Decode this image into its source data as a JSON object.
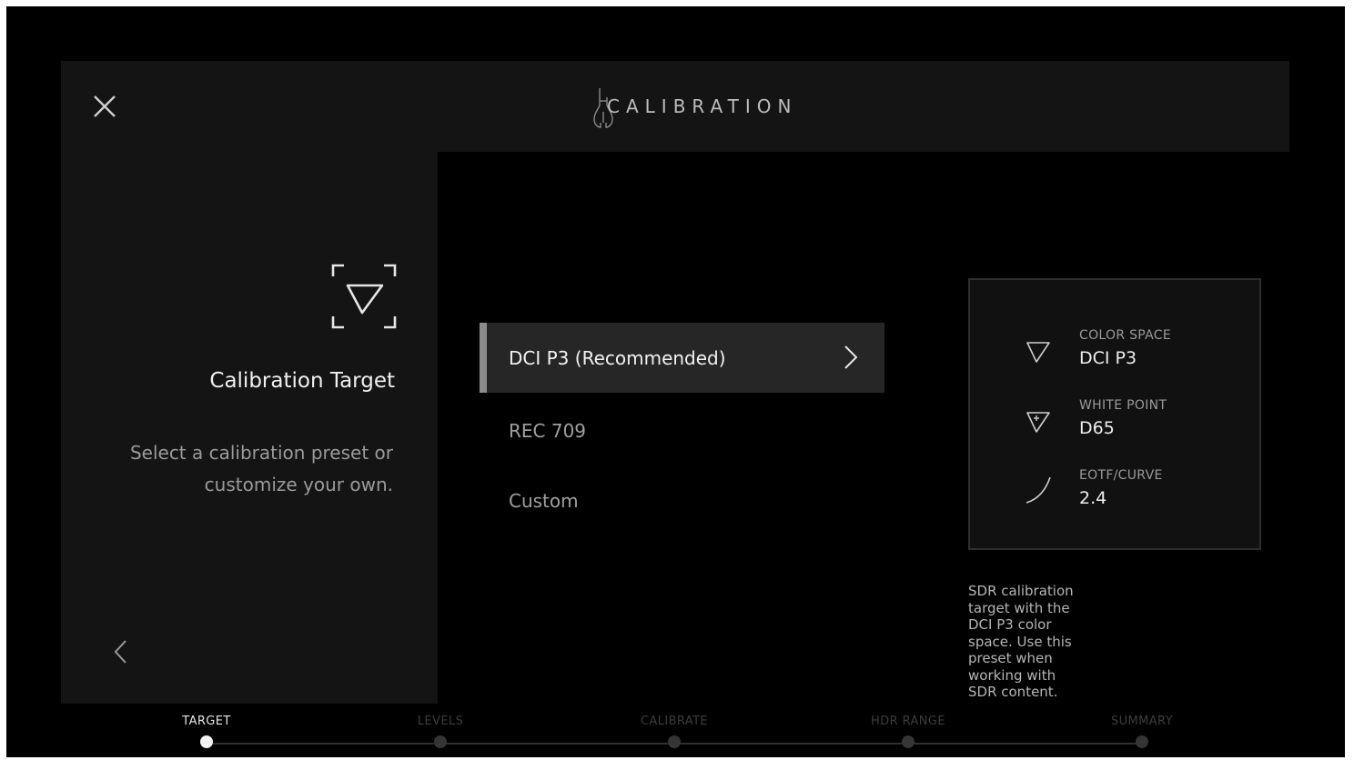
{
  "header": {
    "title": "CALIBRATION",
    "close_icon": "close-icon",
    "logo_icon": "tuning-fork-logo"
  },
  "left_panel": {
    "icon": "target-triangle-icon",
    "title": "Calibration Target",
    "description": "Select a calibration preset or customize your own.",
    "back_icon": "chevron-left-icon"
  },
  "presets": [
    {
      "label": "DCI P3 (Recommended)",
      "selected": true
    },
    {
      "label": "REC 709",
      "selected": false
    },
    {
      "label": "Custom",
      "selected": false
    }
  ],
  "info": {
    "color_space": {
      "label": "COLOR SPACE",
      "value": "DCI P3",
      "icon": "triangle-icon"
    },
    "white_point": {
      "label": "WHITE POINT",
      "value": "D65",
      "icon": "triangle-plus-icon"
    },
    "eotf_curve": {
      "label": "EOTF/CURVE",
      "value": "2.4",
      "icon": "curve-icon"
    }
  },
  "preset_description": "SDR calibration target with the DCI P3 color space. Use this preset when working with SDR content.",
  "steps": [
    {
      "label": "TARGET",
      "active": true
    },
    {
      "label": "LEVELS",
      "active": false
    },
    {
      "label": "CALIBRATE",
      "active": false
    },
    {
      "label": "HDR RANGE",
      "active": false
    },
    {
      "label": "SUMMARY",
      "active": false
    }
  ],
  "colors": {
    "background": "#000000",
    "panel": "#141414",
    "selected_row": "#262626",
    "selected_accent": "#8c8c8c",
    "active_step": "#f2f2f2"
  }
}
